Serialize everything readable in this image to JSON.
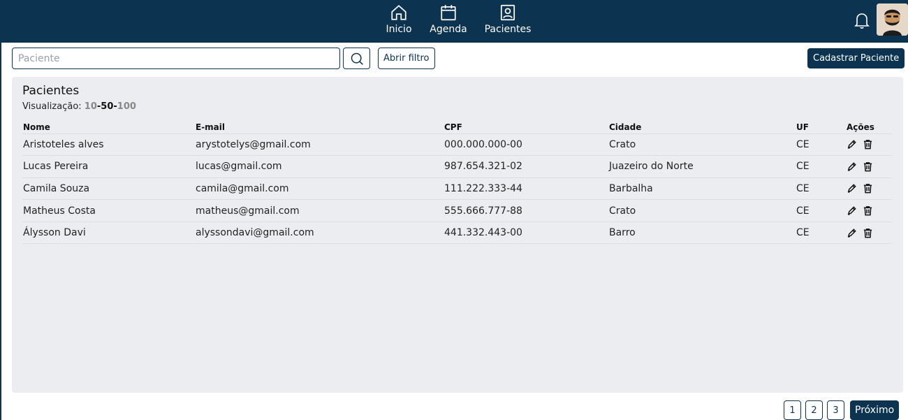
{
  "colors": {
    "primary": "#0c3350",
    "panel_bg": "#ecedf0"
  },
  "nav": {
    "items": [
      {
        "label": "Inicio",
        "icon": "home-icon"
      },
      {
        "label": "Agenda",
        "icon": "calendar-icon"
      },
      {
        "label": "Pacientes",
        "icon": "patient-card-icon"
      }
    ]
  },
  "header": {
    "bell_icon": "bell-icon",
    "avatar_icon": "user-avatar"
  },
  "search": {
    "placeholder": "Paciente",
    "value": "",
    "icon": "search-icon"
  },
  "toolbar": {
    "filter_label": "Abrir filtro",
    "register_label": "Cadastrar Paciente"
  },
  "panel": {
    "title": "Pacientes",
    "view_label": "Visualização: ",
    "view_options": [
      "10",
      "50",
      "100"
    ],
    "view_active": "50"
  },
  "table": {
    "headers": {
      "nome": "Nome",
      "email": "E-mail",
      "cpf": "CPF",
      "cidade": "Cidade",
      "uf": "UF",
      "acoes": "Ações"
    },
    "rows": [
      {
        "nome": "Aristoteles alves",
        "email": "arystotelys@gmail.com",
        "cpf": "000.000.000-00",
        "cidade": "Crato",
        "uf": "CE"
      },
      {
        "nome": "Lucas Pereira",
        "email": "lucas@gmail.com",
        "cpf": "987.654.321-02",
        "cidade": "Juazeiro do Norte",
        "uf": "CE"
      },
      {
        "nome": "Camila Souza",
        "email": "camila@gmail.com",
        "cpf": "111.222.333-44",
        "cidade": "Barbalha",
        "uf": "CE"
      },
      {
        "nome": "Matheus Costa",
        "email": "matheus@gmail.com",
        "cpf": "555.666.777-88",
        "cidade": "Crato",
        "uf": "CE"
      },
      {
        "nome": "Álysson Davi",
        "email": "alyssondavi@gmail.com",
        "cpf": "441.332.443-00",
        "cidade": "Barro",
        "uf": "CE"
      }
    ],
    "action_icons": [
      "edit-pencil-icon",
      "trash-icon"
    ]
  },
  "pagination": {
    "pages": [
      "1",
      "2",
      "3"
    ],
    "next_label": "Próximo"
  }
}
